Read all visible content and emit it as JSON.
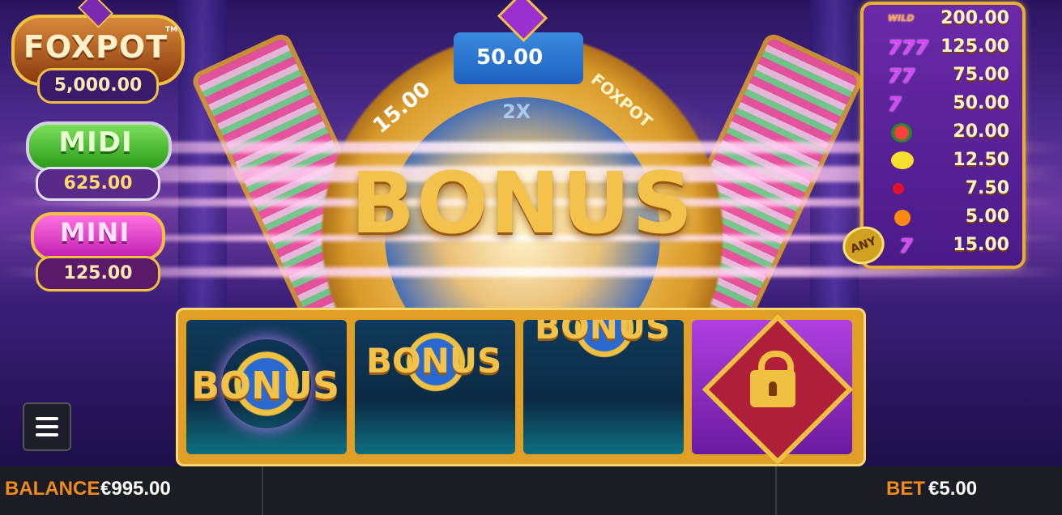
{
  "jackpots": {
    "foxpot": {
      "label": "FOXPOT",
      "tm": "TM",
      "value": "5,000.00"
    },
    "midi": {
      "label": "MIDI",
      "value": "625.00"
    },
    "mini": {
      "label": "MINI",
      "value": "125.00"
    }
  },
  "wheel": {
    "segments": {
      "left": "15.00",
      "top": "50.00",
      "right": "FOXPOT",
      "inner": "2X"
    },
    "center_text": "BONUS"
  },
  "paytable": {
    "rows": [
      {
        "symbol": "wild-fox-icon",
        "symbol_text": "WILD",
        "value": "200.00"
      },
      {
        "symbol": "triple-seven-icon",
        "symbol_text": "777",
        "value": "125.00"
      },
      {
        "symbol": "double-seven-icon",
        "symbol_text": "77",
        "value": "75.00"
      },
      {
        "symbol": "seven-icon",
        "symbol_text": "7",
        "value": "50.00"
      },
      {
        "symbol": "watermelon-icon",
        "symbol_text": "",
        "value": "20.00"
      },
      {
        "symbol": "lemon-icon",
        "symbol_text": "",
        "value": "12.50"
      },
      {
        "symbol": "cherry-icon",
        "symbol_text": "",
        "value": "7.50"
      },
      {
        "symbol": "orange-icon",
        "symbol_text": "",
        "value": "5.00"
      },
      {
        "symbol": "any-seven-icon",
        "symbol_text": "7",
        "value": "15.00"
      }
    ],
    "any_badge": "ANY"
  },
  "reels": [
    {
      "symbol": "bonus",
      "text": "BONUS"
    },
    {
      "symbol": "bonus",
      "text": "BONUS"
    },
    {
      "symbol": "bonus",
      "text": "BONUS"
    },
    {
      "symbol": "lock-icon",
      "text": ""
    }
  ],
  "menu": {
    "icon": "hamburger-menu-icon"
  },
  "footer": {
    "balance_label": "BALANCE",
    "balance_value": "€995.00",
    "bet_label": "BET",
    "bet_value": "€5.00"
  },
  "colors": {
    "accent_orange": "#f08c1e",
    "gold": "#f3c24a",
    "bar_bg": "#1b1c24"
  }
}
